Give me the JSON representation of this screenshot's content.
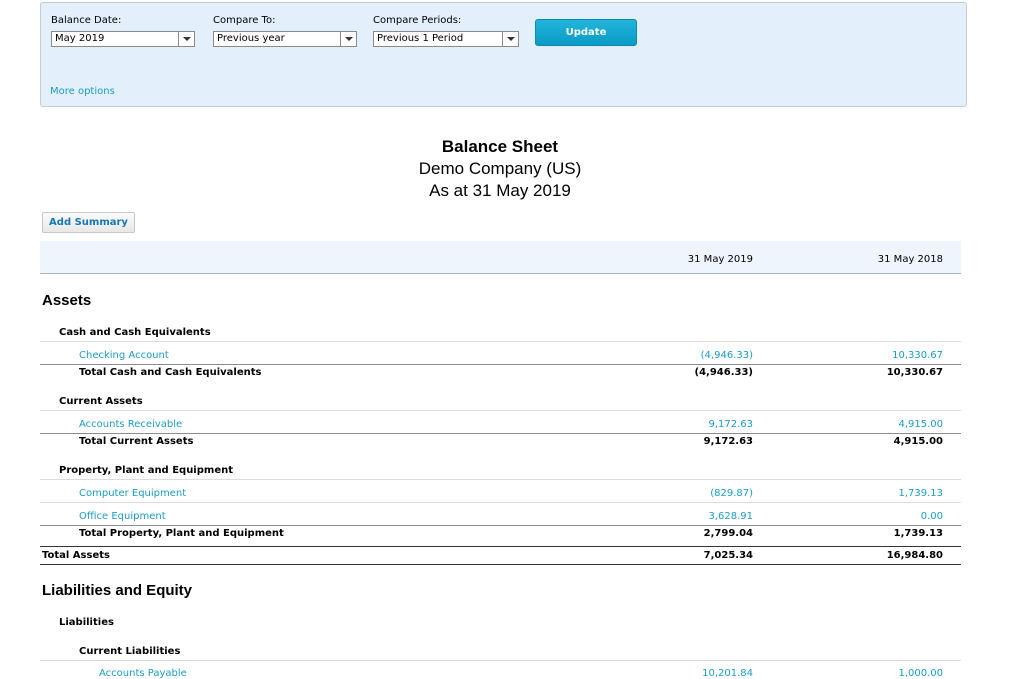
{
  "filters": {
    "balance_date": {
      "label": "Balance Date:",
      "value": "May 2019"
    },
    "compare_to": {
      "label": "Compare To:",
      "value": "Previous year"
    },
    "compare_periods": {
      "label": "Compare Periods:",
      "value": "Previous 1 Period"
    },
    "update_label": "Update",
    "more_options": "More options"
  },
  "report": {
    "title": "Balance Sheet",
    "company": "Demo Company (US)",
    "as_at": "As at 31 May 2019",
    "add_summary": "Add Summary",
    "columns": [
      "31 May 2019",
      "31 May 2018"
    ]
  },
  "rows": {
    "assets": "Assets",
    "cash_group": "Cash and Cash Equivalents",
    "checking": {
      "label": "Checking Account",
      "v1": "(4,946.33)",
      "v2": "10,330.67"
    },
    "total_cash": {
      "label": "Total Cash and Cash Equivalents",
      "v1": "(4,946.33)",
      "v2": "10,330.67"
    },
    "current_assets_group": "Current Assets",
    "ar": {
      "label": "Accounts Receivable",
      "v1": "9,172.63",
      "v2": "4,915.00"
    },
    "total_current_assets": {
      "label": "Total Current Assets",
      "v1": "9,172.63",
      "v2": "4,915.00"
    },
    "ppe_group": "Property, Plant and Equipment",
    "computer": {
      "label": "Computer Equipment",
      "v1": "(829.87)",
      "v2": "1,739.13"
    },
    "office": {
      "label": "Office Equipment",
      "v1": "3,628.91",
      "v2": "0.00"
    },
    "total_ppe": {
      "label": "Total Property, Plant and Equipment",
      "v1": "2,799.04",
      "v2": "1,739.13"
    },
    "total_assets": {
      "label": "Total Assets",
      "v1": "7,025.34",
      "v2": "16,984.80"
    },
    "liab_equity": "Liabilities and Equity",
    "liabilities_group": "Liabilities",
    "current_liabilities_group": "Current Liabilities",
    "ap": {
      "label": "Accounts Payable",
      "v1": "10,201.84",
      "v2": "1,000.00"
    }
  }
}
